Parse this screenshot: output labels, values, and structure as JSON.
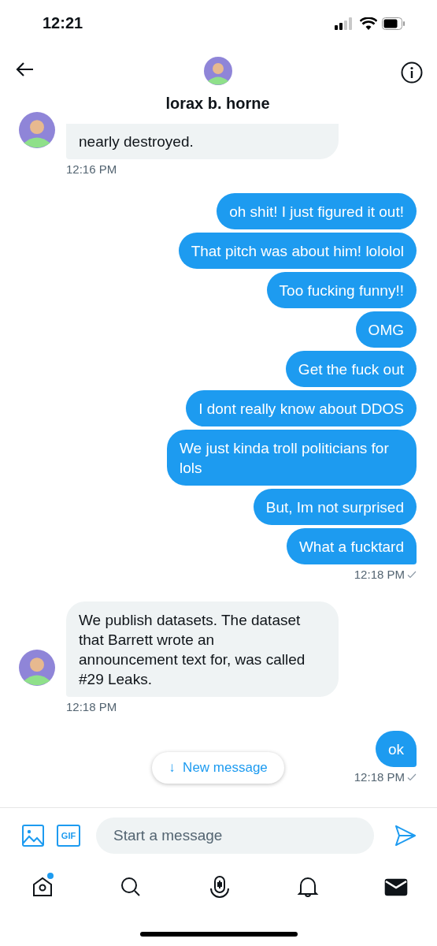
{
  "status_bar": {
    "time": "12:21"
  },
  "header": {
    "name": "lorax b. horne"
  },
  "groups": [
    {
      "kind": "received",
      "messages": [
        "nearly destroyed."
      ],
      "time": "12:16 PM",
      "delivered": false
    },
    {
      "kind": "sent",
      "messages": [
        "oh shit! I just figured it out!",
        "That pitch was about him! lololol",
        "Too fucking funny!!",
        "OMG",
        "Get the fuck out",
        "I dont really know about DDOS",
        "We just kinda troll politicians for lols",
        "But, Im not surprised",
        "What a fucktard"
      ],
      "time": "12:18 PM",
      "delivered": true
    },
    {
      "kind": "received",
      "messages": [
        "We publish datasets. The dataset that Barrett wrote an announcement text for, was called #29 Leaks."
      ],
      "time": "12:18 PM",
      "delivered": false
    },
    {
      "kind": "sent",
      "messages": [
        "ok"
      ],
      "time": "12:18 PM",
      "delivered": true
    }
  ],
  "new_message_pill": {
    "arrow": "↓",
    "label": "New message"
  },
  "composer": {
    "gif_label": "GIF",
    "placeholder": "Start a message"
  },
  "tabs": [
    {
      "kind": "home",
      "selected": false,
      "badge": true
    },
    {
      "kind": "search",
      "selected": false,
      "badge": false
    },
    {
      "kind": "spaces",
      "selected": false,
      "badge": false
    },
    {
      "kind": "notifications",
      "selected": false,
      "badge": false
    },
    {
      "kind": "messages",
      "selected": true,
      "badge": false
    }
  ]
}
